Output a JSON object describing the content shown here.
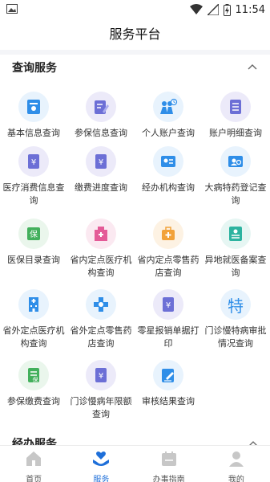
{
  "status_bar": {
    "time": "11:54"
  },
  "app_bar": {
    "title": "服务平台"
  },
  "sections": {
    "query": {
      "title": "查询服务"
    },
    "handling": {
      "title": "经办服务"
    }
  },
  "query_items": [
    {
      "label": "基本信息查询",
      "icon": "id-card-icon"
    },
    {
      "label": "参保信息查询",
      "icon": "document-pen-icon"
    },
    {
      "label": "个人账户查询",
      "icon": "people-clock-icon"
    },
    {
      "label": "账户明细查询",
      "icon": "list-document-icon"
    },
    {
      "label": "医疗消费信息查询",
      "icon": "yen-document-icon"
    },
    {
      "label": "缴费进度查询",
      "icon": "yen-document-icon"
    },
    {
      "label": "经办机构查询",
      "icon": "contact-card-icon"
    },
    {
      "label": "大病特药登记查询",
      "icon": "person-card-icon"
    },
    {
      "label": "医保目录查询",
      "icon": "insurance-card-icon"
    },
    {
      "label": "省内定点医疗机构查询",
      "icon": "hospital-icon"
    },
    {
      "label": "省内定点零售药店查询",
      "icon": "pharmacy-kit-icon"
    },
    {
      "label": "异地就医备案查询",
      "icon": "registry-icon"
    },
    {
      "label": "省外定点医疗机构查询",
      "icon": "hospital-building-icon"
    },
    {
      "label": "省外定点零售药店查询",
      "icon": "medical-cross-icon"
    },
    {
      "label": "零星报销单据打印",
      "icon": "yen-document-icon"
    },
    {
      "label": "门诊慢特病审批情况查询",
      "icon": "special-char-icon",
      "glyph": "特"
    },
    {
      "label": "参保缴费查询",
      "icon": "insurance-doc-icon"
    },
    {
      "label": "门诊慢病年限额查询",
      "icon": "yen-document-icon"
    },
    {
      "label": "审核结果查询",
      "icon": "pen-document-icon"
    }
  ],
  "bottom_nav": [
    {
      "label": "首页",
      "icon": "home-icon",
      "active": false
    },
    {
      "label": "服务",
      "icon": "service-hands-icon",
      "active": true
    },
    {
      "label": "办事指南",
      "icon": "guide-calendar-icon",
      "active": false
    },
    {
      "label": "我的",
      "icon": "profile-icon",
      "active": false
    }
  ],
  "colors": {
    "accent": "#1e6fd9",
    "icon_blue": "#2f8ee8",
    "icon_purple": "#6c6fd6",
    "icon_green": "#43b05c",
    "icon_pink": "#e45a97",
    "icon_orange": "#f2a23a",
    "icon_teal": "#2cb3a0"
  }
}
